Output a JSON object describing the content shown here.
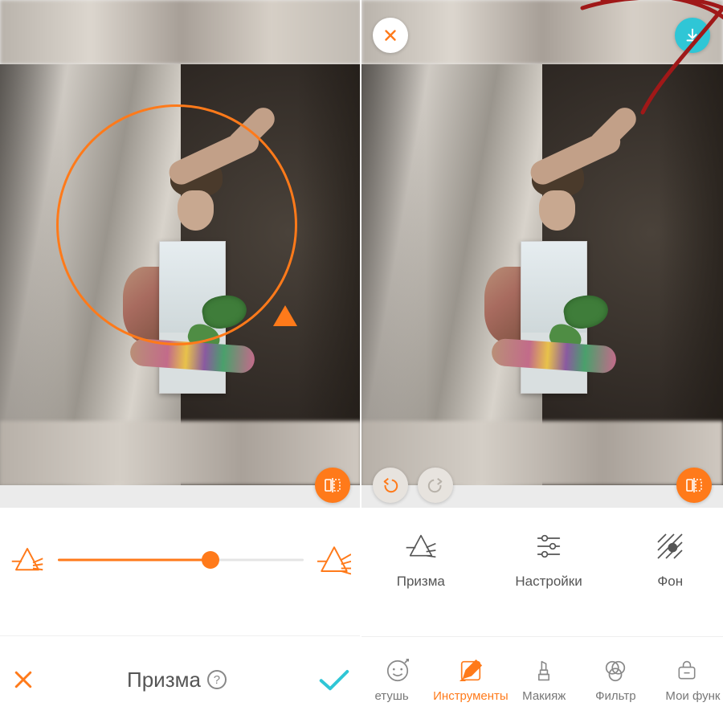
{
  "accent": "#ff7a1a",
  "cyan": "#2fc6d6",
  "left": {
    "tool_title": "Призма",
    "slider_value": 62,
    "icon_low": "prism-low-icon",
    "icon_high": "prism-high-icon"
  },
  "right": {
    "tools": [
      {
        "label": "Призма",
        "icon": "prism-icon"
      },
      {
        "label": "Настройки",
        "icon": "sliders-icon"
      },
      {
        "label": "Фон",
        "icon": "hatch-icon"
      }
    ],
    "tabs": [
      {
        "label": "етушь",
        "icon": "face-icon",
        "active": false
      },
      {
        "label": "Инструменты",
        "icon": "pencil-icon",
        "active": true
      },
      {
        "label": "Макияж",
        "icon": "lipstick-icon",
        "active": false
      },
      {
        "label": "Фильтр",
        "icon": "circles-icon",
        "active": false
      },
      {
        "label": "Мои функ",
        "icon": "bag-icon",
        "active": false
      }
    ]
  }
}
